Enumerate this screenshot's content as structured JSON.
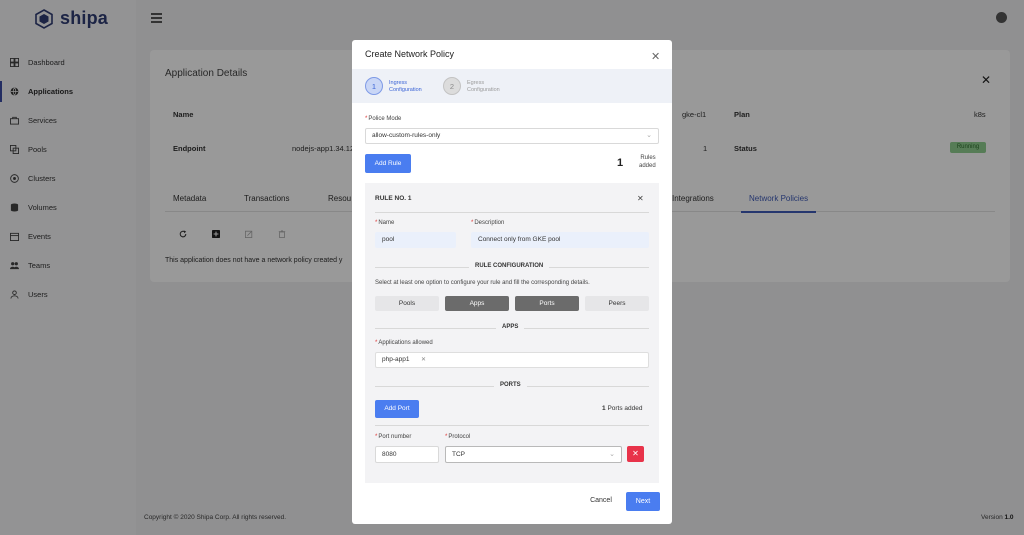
{
  "app": {
    "brand": "shipa",
    "accent_color": "#3b4ba4",
    "primary_button_color": "#4a7df0"
  },
  "sidebar": {
    "items": [
      {
        "label": "Dashboard",
        "icon": "dashboard-icon"
      },
      {
        "label": "Applications",
        "icon": "globe-icon",
        "active": true
      },
      {
        "label": "Services",
        "icon": "services-icon"
      },
      {
        "label": "Pools",
        "icon": "pools-icon"
      },
      {
        "label": "Clusters",
        "icon": "clusters-icon"
      },
      {
        "label": "Volumes",
        "icon": "database-icon"
      },
      {
        "label": "Events",
        "icon": "calendar-icon"
      },
      {
        "label": "Teams",
        "icon": "teams-icon"
      },
      {
        "label": "Users",
        "icon": "user-icon"
      }
    ]
  },
  "details": {
    "title": "Application Details",
    "name_label": "Name",
    "endpoint_label": "Endpoint",
    "endpoint_value": "nodejs-app1.34.12",
    "cluster_value": "gke-cl1",
    "units_value": "1",
    "plan_label": "Plan",
    "plan_value": "k8s",
    "status_label": "Status",
    "status_value": "Running",
    "tabs": [
      "Metadata",
      "Transactions",
      "Resou",
      "Integrations",
      "Network Policies"
    ],
    "no_policy_text": "This application does not have a network policy created y"
  },
  "footer": {
    "copyright": "Copyright © 2020 Shipa Corp. All rights reserved.",
    "version_label": "Version",
    "version_value": "1.0"
  },
  "modal": {
    "title": "Create Network Policy",
    "steps": [
      {
        "number": "1",
        "line1": "Ingress",
        "line2": "Configuration",
        "active": true
      },
      {
        "number": "2",
        "line1": "Egress",
        "line2": "Configuration",
        "active": false
      }
    ],
    "police_mode_label": "Police Mode",
    "police_mode_value": "allow-custom-rules-only",
    "add_rule_label": "Add Rule",
    "rules_count": "1",
    "rules_added_line1": "Rules",
    "rules_added_line2": "added",
    "rule": {
      "heading": "RULE NO. 1",
      "name_label": "Name",
      "name_value": "pool",
      "description_label": "Description",
      "description_value": "Connect only from GKE pool",
      "rule_config_title": "RULE CONFIGURATION",
      "hint": "Select at least one option to configure your rule and fill the corresponding details.",
      "options": [
        {
          "label": "Pools",
          "selected": false
        },
        {
          "label": "Apps",
          "selected": true
        },
        {
          "label": "Ports",
          "selected": true
        },
        {
          "label": "Peers",
          "selected": false
        }
      ],
      "apps_title": "APPS",
      "apps_allowed_label": "Applications allowed",
      "apps_allowed_tags": [
        "php-app1"
      ],
      "ports_title": "PORTS",
      "add_port_label": "Add Port",
      "ports_count": "1",
      "ports_added_label": "Ports added",
      "port_number_label": "Port number",
      "port_number_value": "8080",
      "protocol_label": "Protocol",
      "protocol_value": "TCP"
    },
    "cancel_label": "Cancel",
    "next_label": "Next"
  }
}
